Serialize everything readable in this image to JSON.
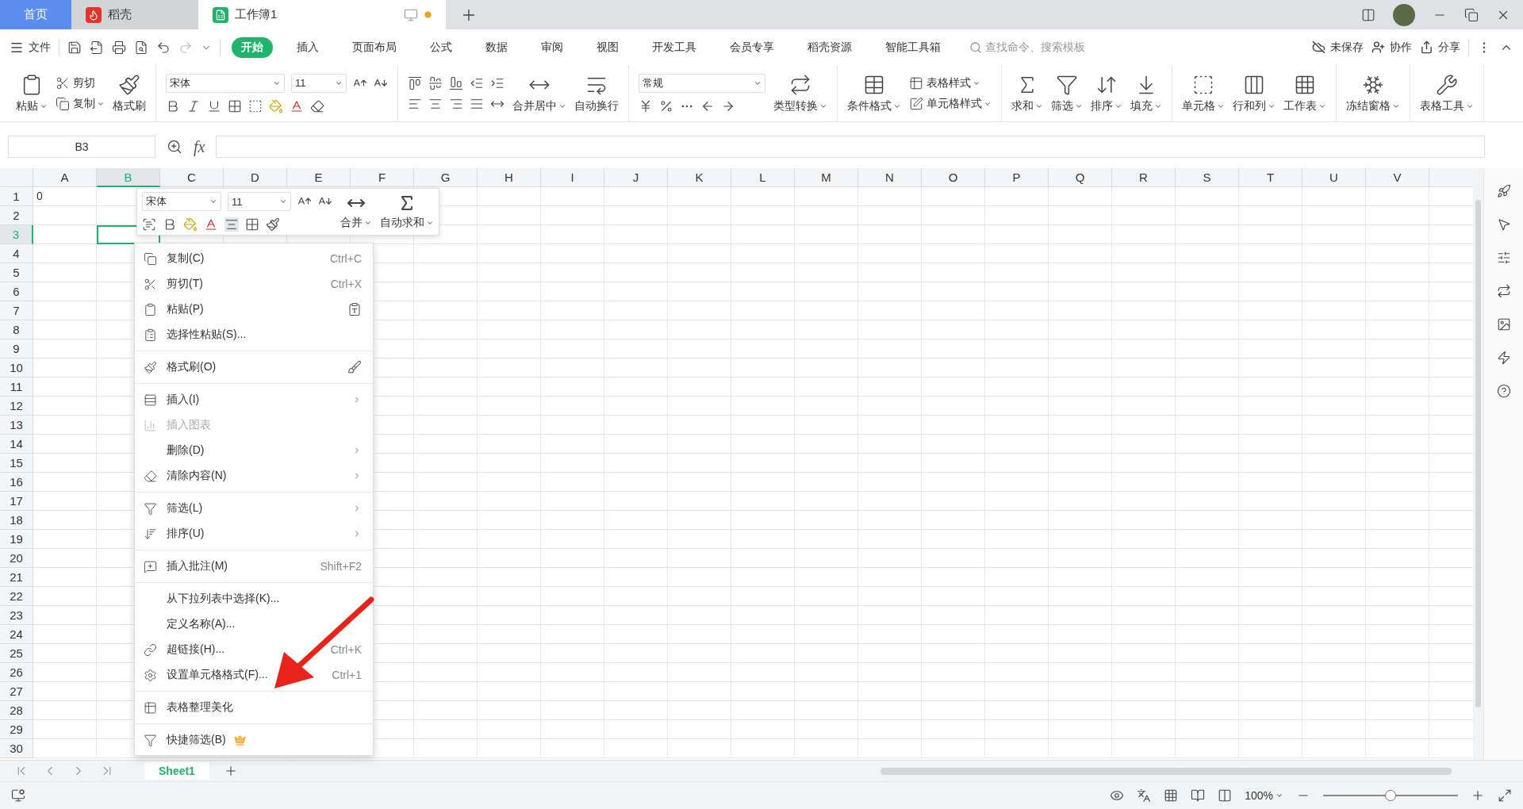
{
  "tabs": [
    {
      "label": "首页",
      "kind": "home",
      "selected": false
    },
    {
      "label": "稻壳",
      "kind": "docer",
      "selected": false
    },
    {
      "label": "工作簿1",
      "kind": "sheet",
      "selected": true
    }
  ],
  "menu": {
    "file": "文件",
    "tabs": [
      {
        "label": "开始",
        "selected": true
      },
      {
        "label": "插入",
        "selected": false
      },
      {
        "label": "页面布局",
        "selected": false
      },
      {
        "label": "公式",
        "selected": false
      },
      {
        "label": "数据",
        "selected": false
      },
      {
        "label": "审阅",
        "selected": false
      },
      {
        "label": "视图",
        "selected": false
      },
      {
        "label": "开发工具",
        "selected": false
      },
      {
        "label": "会员专享",
        "selected": false
      },
      {
        "label": "稻壳资源",
        "selected": false
      },
      {
        "label": "智能工具箱",
        "selected": false
      }
    ],
    "search": {
      "placeholder": "查找命令、搜索模板"
    },
    "actions": [
      "未保存",
      "协作",
      "分享"
    ]
  },
  "ribbon": [
    {
      "kind": "clipboard",
      "buttons": [
        {
          "label": "粘贴",
          "caret": true
        },
        {
          "label": "剪切",
          "caret": false
        },
        {
          "label": "复制",
          "caret": true
        },
        {
          "label": "格式刷",
          "caret": false
        }
      ]
    },
    {
      "kind": "font",
      "font": "宋体",
      "size": "11"
    },
    {
      "kind": "align",
      "buttons": [
        {
          "label": "合并居中",
          "caret": true
        },
        {
          "label": "自动换行",
          "caret": false
        }
      ]
    },
    {
      "kind": "number",
      "format": "常规",
      "buttons": [
        {
          "label": "类型转换",
          "caret": true
        }
      ]
    },
    {
      "kind": "styles",
      "buttons": [
        {
          "label": "条件格式",
          "caret": true
        },
        {
          "label": "表格样式",
          "caret": true
        },
        {
          "label": "单元格样式",
          "caret": true
        }
      ]
    },
    {
      "kind": "tools",
      "buttons": [
        {
          "label": "求和",
          "caret": true
        },
        {
          "label": "筛选",
          "caret": true
        },
        {
          "label": "排序",
          "caret": true
        },
        {
          "label": "填充",
          "caret": true
        }
      ]
    },
    {
      "kind": "tools",
      "buttons": [
        {
          "label": "单元格",
          "caret": true
        },
        {
          "label": "行和列",
          "caret": true
        },
        {
          "label": "工作表",
          "caret": true
        }
      ]
    },
    {
      "kind": "tools",
      "buttons": [
        {
          "label": "冻结窗格",
          "caret": true
        }
      ]
    },
    {
      "kind": "tools",
      "buttons": [
        {
          "label": "表格工具",
          "caret": true
        }
      ]
    }
  ],
  "formula_bar": {
    "name_box": "B3",
    "fx": "fx"
  },
  "columns": [
    {
      "label": "A",
      "selected": false
    },
    {
      "label": "B",
      "selected": true
    },
    {
      "label": "C",
      "selected": false
    },
    {
      "label": "D",
      "selected": false
    },
    {
      "label": "E",
      "selected": false
    },
    {
      "label": "F",
      "selected": false
    },
    {
      "label": "G",
      "selected": false
    },
    {
      "label": "H",
      "selected": false
    },
    {
      "label": "I",
      "selected": false
    },
    {
      "label": "J",
      "selected": false
    },
    {
      "label": "K",
      "selected": false
    },
    {
      "label": "L",
      "selected": false
    },
    {
      "label": "M",
      "selected": false
    },
    {
      "label": "N",
      "selected": false
    },
    {
      "label": "O",
      "selected": false
    },
    {
      "label": "P",
      "selected": false
    },
    {
      "label": "Q",
      "selected": false
    },
    {
      "label": "R",
      "selected": false
    },
    {
      "label": "S",
      "selected": false
    },
    {
      "label": "T",
      "selected": false
    },
    {
      "label": "U",
      "selected": false
    },
    {
      "label": "V",
      "selected": false
    }
  ],
  "rows": [
    {
      "label": "1",
      "selected": false,
      "cells": [
        "0"
      ]
    },
    {
      "label": "2",
      "selected": false
    },
    {
      "label": "3",
      "selected": true
    },
    {
      "label": "4",
      "selected": false
    },
    {
      "label": "5",
      "selected": false
    },
    {
      "label": "6",
      "selected": false
    },
    {
      "label": "7",
      "selected": false
    },
    {
      "label": "8",
      "selected": false
    },
    {
      "label": "9",
      "selected": false
    },
    {
      "label": "10",
      "selected": false
    },
    {
      "label": "11",
      "selected": false
    },
    {
      "label": "12",
      "selected": false
    },
    {
      "label": "13",
      "selected": false
    },
    {
      "label": "14",
      "selected": false
    },
    {
      "label": "15",
      "selected": false
    },
    {
      "label": "16",
      "selected": false
    },
    {
      "label": "17",
      "selected": false
    },
    {
      "label": "18",
      "selected": false
    },
    {
      "label": "19",
      "selected": false
    },
    {
      "label": "20",
      "selected": false
    },
    {
      "label": "21",
      "selected": false
    },
    {
      "label": "22",
      "selected": false
    },
    {
      "label": "23",
      "selected": false
    },
    {
      "label": "24",
      "selected": false
    },
    {
      "label": "25",
      "selected": false
    },
    {
      "label": "26",
      "selected": false
    },
    {
      "label": "27",
      "selected": false
    },
    {
      "label": "28",
      "selected": false
    },
    {
      "label": "29",
      "selected": false
    },
    {
      "label": "30",
      "selected": false
    }
  ],
  "mini_toolbar": {
    "font": "宋体",
    "size": "11",
    "buttons": [
      "合并",
      "自动求和"
    ]
  },
  "context_menu": [
    [
      {
        "label": "复制(C)",
        "shortcut": "Ctrl+C"
      },
      {
        "label": "剪切(T)",
        "shortcut": "Ctrl+X"
      },
      {
        "label": "粘贴(P)",
        "side_button": true
      },
      {
        "label": "选择性粘贴(S)..."
      }
    ],
    [
      {
        "label": "格式刷(O)",
        "side_button": true
      }
    ],
    [
      {
        "label": "插入(I)",
        "submenu": true
      },
      {
        "label": "插入图表",
        "disabled": true
      },
      {
        "label": "删除(D)",
        "submenu": true
      },
      {
        "label": "清除内容(N)",
        "submenu": true
      }
    ],
    [
      {
        "label": "筛选(L)",
        "submenu": true
      },
      {
        "label": "排序(U)",
        "submenu": true
      }
    ],
    [
      {
        "label": "插入批注(M)",
        "shortcut": "Shift+F2"
      }
    ],
    [
      {
        "label": "从下拉列表中选择(K)..."
      },
      {
        "label": "定义名称(A)..."
      },
      {
        "label": "超链接(H)...",
        "shortcut": "Ctrl+K"
      },
      {
        "label": "设置单元格格式(F)...",
        "shortcut": "Ctrl+1"
      }
    ],
    [
      {
        "label": "表格整理美化"
      }
    ],
    [
      {
        "label": "快捷筛选(B)",
        "premium": true
      }
    ]
  ],
  "sheets": [
    {
      "label": "Sheet1",
      "selected": true
    }
  ],
  "status": {
    "zoom": "100%",
    "level": 0.5
  }
}
